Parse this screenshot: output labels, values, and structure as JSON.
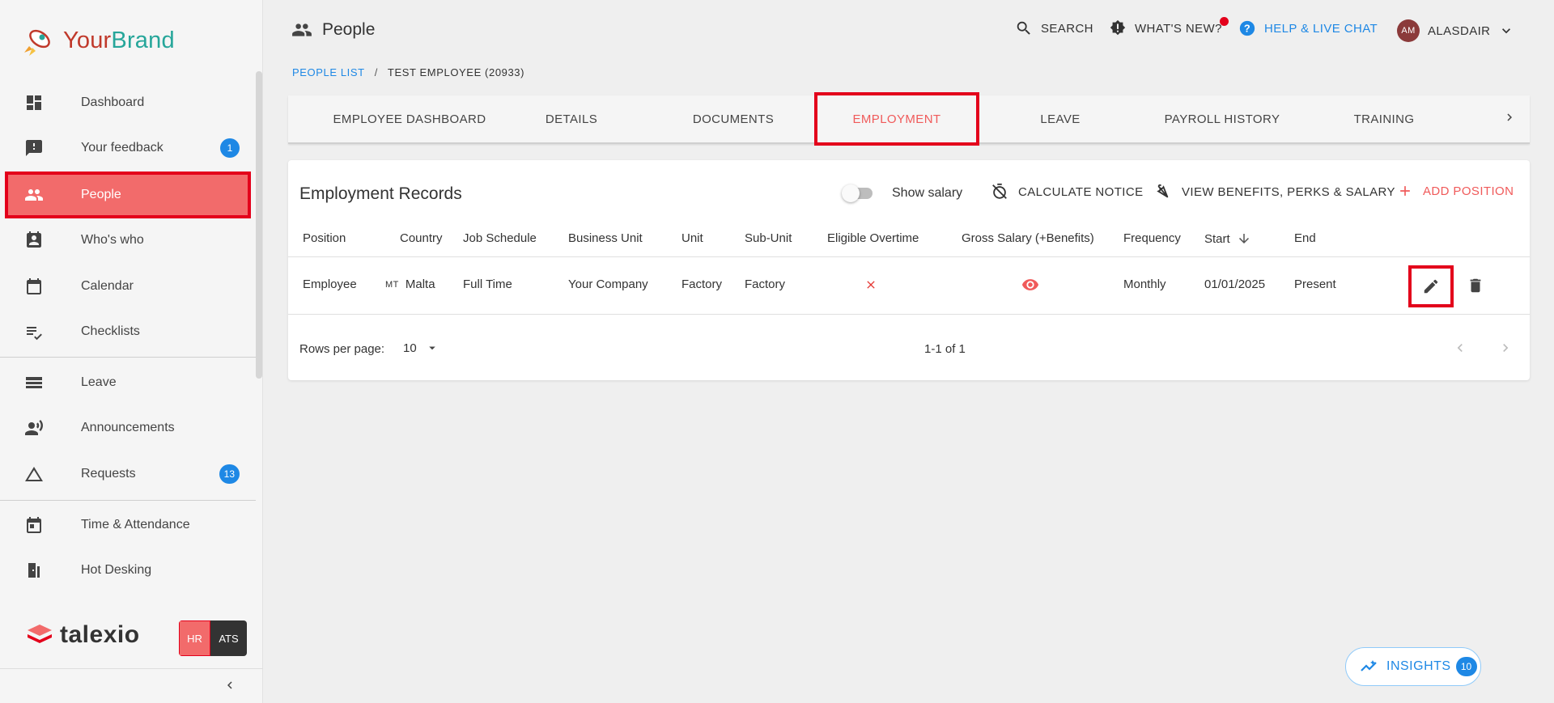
{
  "brand": {
    "part1": "Your",
    "part2": "Brand"
  },
  "sidebar": {
    "items": [
      {
        "label": "Dashboard",
        "icon": "dashboard-icon"
      },
      {
        "label": "Your feedback",
        "icon": "feedback-icon",
        "badge": "1"
      },
      {
        "label": "People",
        "icon": "people-icon",
        "active": true
      },
      {
        "label": "Who's who",
        "icon": "contact-card-icon"
      },
      {
        "label": "Calendar",
        "icon": "calendar-icon"
      },
      {
        "label": "Checklists",
        "icon": "checklist-icon"
      },
      {
        "label": "Leave",
        "icon": "leave-icon"
      },
      {
        "label": "Announcements",
        "icon": "announcement-icon"
      },
      {
        "label": "Requests",
        "icon": "triangle-icon",
        "badge": "13"
      },
      {
        "label": "Time & Attendance",
        "icon": "time-attendance-icon"
      },
      {
        "label": "Hot Desking",
        "icon": "door-icon"
      }
    ],
    "footer": {
      "logo": "talexio",
      "hr": "HR",
      "ats": "ATS"
    }
  },
  "header": {
    "title": "People",
    "search": "SEARCH",
    "whats_new": "WHAT'S NEW?",
    "help": "HELP & LIVE CHAT",
    "user_initials": "AM",
    "user_name": "ALASDAIR"
  },
  "breadcrumb": {
    "link": "PEOPLE LIST",
    "separator": "/",
    "current": "TEST EMPLOYEE (20933)"
  },
  "tabs": [
    "EMPLOYEE DASHBOARD",
    "DETAILS",
    "DOCUMENTS",
    "EMPLOYMENT",
    "LEAVE",
    "PAYROLL HISTORY",
    "TRAINING"
  ],
  "active_tab": "EMPLOYMENT",
  "card": {
    "title": "Employment Records",
    "show_salary": "Show salary",
    "calculate_notice": "CALCULATE NOTICE",
    "view_benefits": "VIEW BENEFITS, PERKS & SALARY",
    "add_position": "ADD POSITION",
    "columns": [
      "Position",
      "Country",
      "Job Schedule",
      "Business Unit",
      "Unit",
      "Sub-Unit",
      "Eligible Overtime",
      "Gross Salary (+Benefits)",
      "Frequency",
      "Start",
      "End"
    ],
    "row": {
      "position": "Employee",
      "country_code": "MT",
      "country": "Malta",
      "job_schedule": "Full Time",
      "business_unit": "Your Company",
      "unit": "Factory",
      "sub_unit": "Factory",
      "frequency": "Monthly",
      "start": "01/01/2025",
      "end": "Present"
    },
    "rows_per_page_label": "Rows per page:",
    "rows_per_page": "10",
    "range": "1-1 of 1"
  },
  "insights": {
    "label": "INSIGHTS",
    "count": "10"
  },
  "colors": {
    "accent": "#e3001b",
    "active_bg": "#f26b6b",
    "link": "#1e88e5"
  }
}
